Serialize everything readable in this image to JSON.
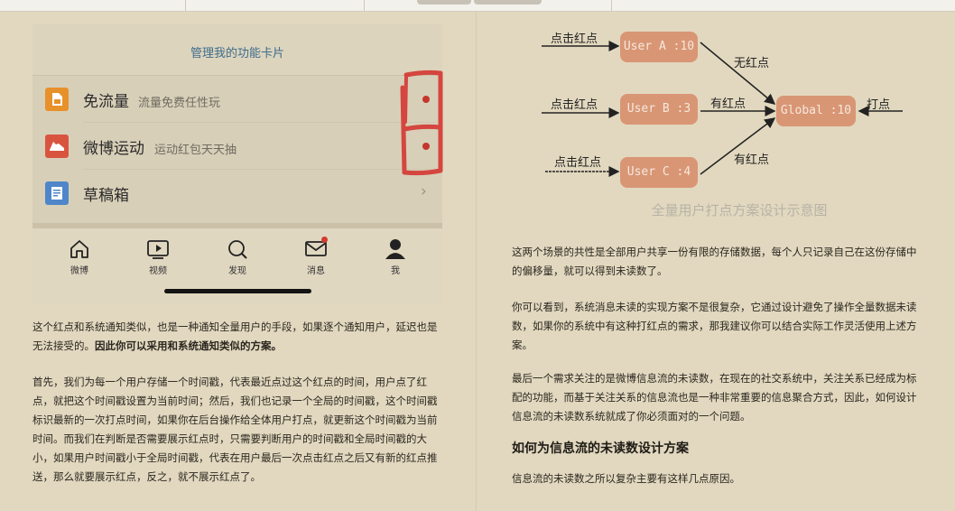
{
  "phone": {
    "card_title": "管理我的功能卡片",
    "rows": [
      {
        "title": "免流量",
        "subtitle": "流量免费任性玩",
        "icon": "sim-card-icon",
        "color": "#e7912b"
      },
      {
        "title": "微博运动",
        "subtitle": "运动红包天天抽",
        "icon": "sneaker-icon",
        "color": "#d9543f"
      },
      {
        "title": "草稿箱",
        "subtitle": "",
        "icon": "draft-icon",
        "color": "#4e86c9"
      }
    ],
    "tabs": [
      {
        "label": "微博",
        "icon": "home-icon"
      },
      {
        "label": "视频",
        "icon": "video-icon"
      },
      {
        "label": "发现",
        "icon": "search-icon"
      },
      {
        "label": "消息",
        "icon": "message-icon"
      },
      {
        "label": "我",
        "icon": "profile-icon"
      }
    ]
  },
  "left": {
    "p1_text": "这个红点和系统通知类似，也是一种通知全量用户的手段，如果逐个通知用户，延迟也是无法接受的。",
    "p1_bold": "因此你可以采用和系统通知类似的方案。",
    "p2": "首先，我们为每一个用户存储一个时间戳，代表最近点过这个红点的时间，用户点了红点，就把这个时间戳设置为当前时间；然后，我们也记录一个全局的时间戳，这个时间戳标识最新的一次打点时间，如果你在后台操作给全体用户打点，就更新这个时间戳为当前时间。而我们在判断是否需要展示红点时，只需要判断用户的时间戳和全局时间戳的大小，如果用户时间戳小于全局时间戳，代表在用户最后一次点击红点之后又有新的红点推送，那么就要展示红点，反之，就不展示红点了。"
  },
  "diagram": {
    "click_label": "点击红点",
    "has_dot": "有红点",
    "no_dot": "无红点",
    "mark": "打点",
    "user_a": "User A :10",
    "user_b": "User B :3",
    "user_c": "User C :4",
    "global": "Global :10",
    "caption": "全量用户打点方案设计示意图"
  },
  "right": {
    "p1": "这两个场景的共性是全部用户共享一份有限的存储数据，每个人只记录自己在这份存储中的偏移量，就可以得到未读数了。",
    "p2": "你可以看到，系统消息未读的实现方案不是很复杂，它通过设计避免了操作全量数据未读数，如果你的系统中有这种打红点的需求，那我建议你可以结合实际工作灵活使用上述方案。",
    "p3": "最后一个需求关注的是微博信息流的未读数，在现在的社交系统中，关注关系已经成为标配的功能，而基于关注关系的信息流也是一种非常重要的信息聚合方式，因此，如何设计信息流的未读数系统就成了你必须面对的一个问题。",
    "heading": "如何为信息流的未读数设计方案",
    "p4": "信息流的未读数之所以复杂主要有这样几点原因。"
  }
}
